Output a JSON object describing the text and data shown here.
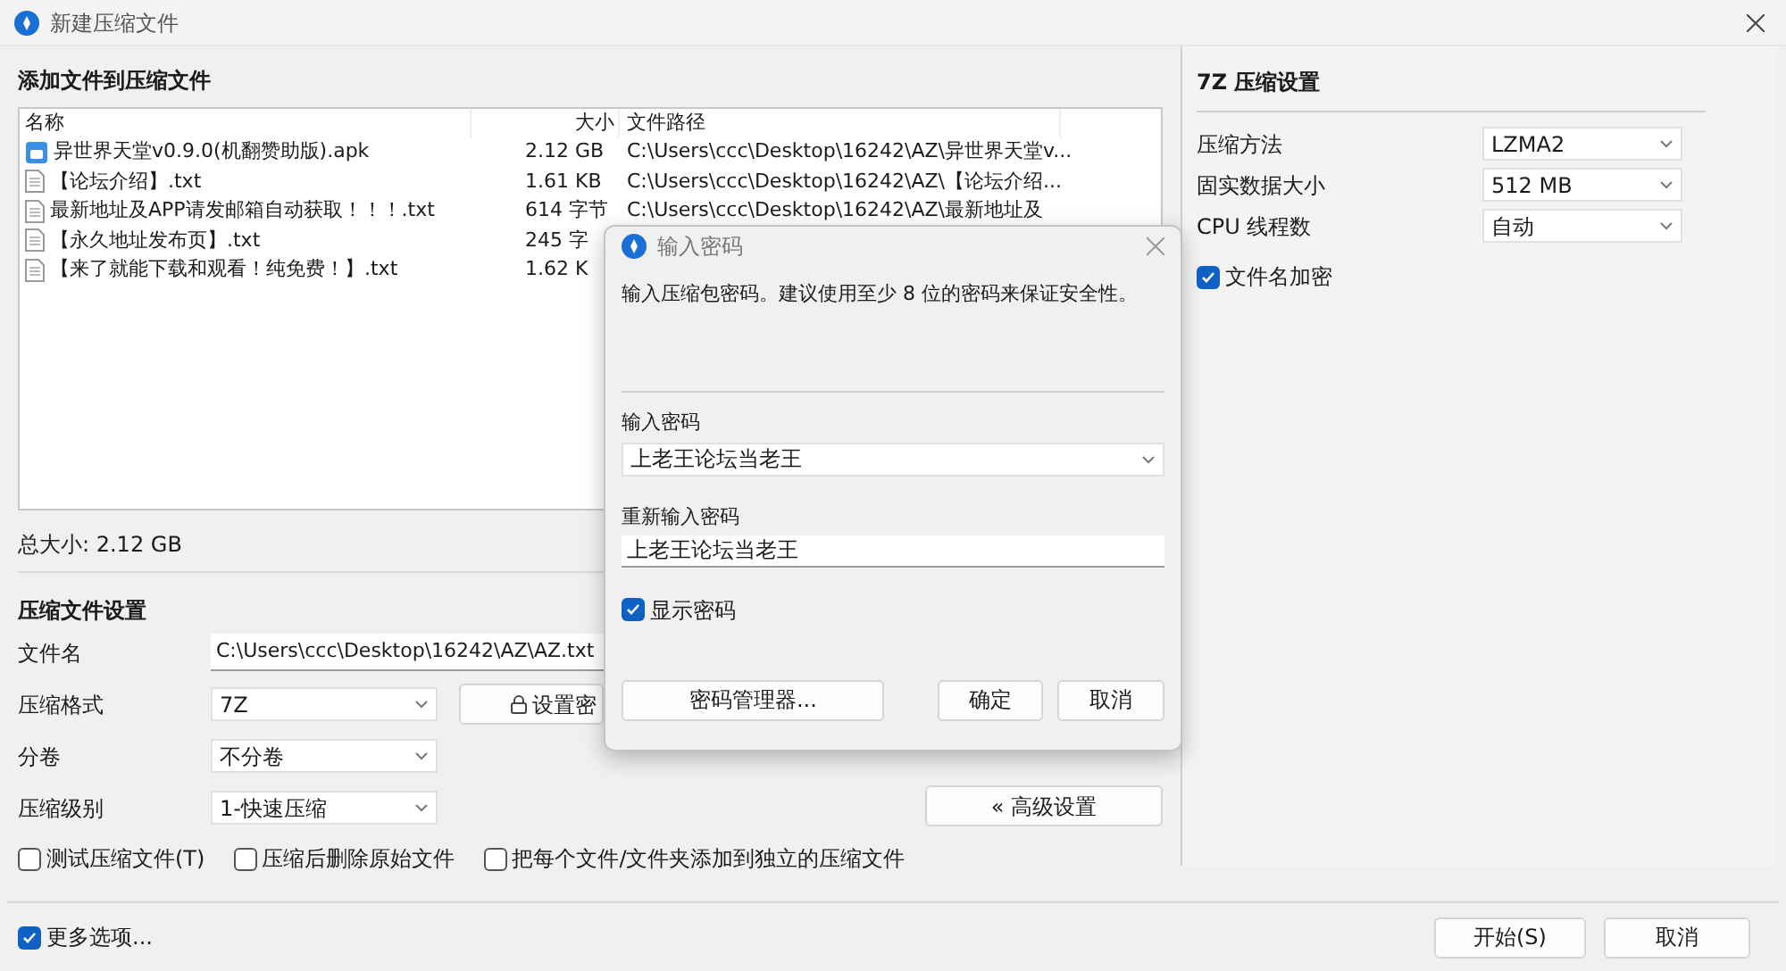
{
  "window": {
    "title": "新建压缩文件"
  },
  "add_section": {
    "title": "添加文件到压缩文件",
    "columns": [
      "名称",
      "大小",
      "文件路径"
    ],
    "files": [
      {
        "kind": "apk",
        "name": "异世界天堂v0.9.0(机翻赞助版).apk",
        "size": "2.12 GB",
        "path": "C:\\Users\\ccc\\Desktop\\16242\\AZ\\异世界天堂v..."
      },
      {
        "kind": "txt",
        "name": "【论坛介绍】.txt",
        "size": "1.61 KB",
        "path": "C:\\Users\\ccc\\Desktop\\16242\\AZ\\【论坛介绍..."
      },
      {
        "kind": "txt",
        "name": "最新地址及APP请发邮箱自动获取！！！.txt",
        "size": "614 字节",
        "path": "C:\\Users\\ccc\\Desktop\\16242\\AZ\\最新地址及"
      },
      {
        "kind": "txt",
        "name": "【永久地址发布页】.txt",
        "size": "245 字"
      },
      {
        "kind": "txt",
        "name": "【来了就能下载和观看！纯免费！】.txt",
        "size": "1.62 K"
      }
    ],
    "total": "总大小: 2.12 GB"
  },
  "archive_settings": {
    "title": "压缩文件设置",
    "fields": [
      {
        "kind": "text",
        "label": "文件名",
        "value": "C:\\Users\\ccc\\Desktop\\16242\\AZ\\AZ.txt"
      },
      {
        "kind": "select",
        "label": "压缩格式",
        "value": "7Z"
      },
      {
        "kind": "select",
        "label": "分卷",
        "value": "不分卷"
      },
      {
        "kind": "select",
        "label": "压缩级别",
        "value": "1-快速压缩"
      }
    ],
    "password_button": "设置密",
    "advanced_button": "« 高级设置",
    "options": [
      {
        "label": "测试压缩文件(T)",
        "checked": false
      },
      {
        "label": "压缩后删除原始文件",
        "checked": false
      },
      {
        "label": "把每个文件/文件夹添加到独立的压缩文件",
        "checked": false
      }
    ]
  },
  "more_options": {
    "label": "更多选项...",
    "checked": true
  },
  "buttons": [
    "开始(S)",
    "取消"
  ],
  "seven_z": {
    "title": "7Z 压缩设置",
    "fields": [
      {
        "label": "压缩方法",
        "value": "LZMA2"
      },
      {
        "label": "固实数据大小",
        "value": "512 MB"
      },
      {
        "label": "CPU 线程数",
        "value": "自动"
      }
    ],
    "filename_encrypt": {
      "label": "文件名加密",
      "checked": true
    }
  },
  "dialog": {
    "title": "输入密码",
    "description": "输入压缩包密码。建议使用至少 8 位的密码来保证安全性。",
    "password_label": "输入密码",
    "password_value": "上老王论坛当老王",
    "reenter_label": "重新输入密码",
    "reenter_value": "上老王论坛当老王",
    "show_password": {
      "label": "显示密码",
      "checked": true
    },
    "buttons": [
      "密码管理器...",
      "确定",
      "取消"
    ]
  }
}
